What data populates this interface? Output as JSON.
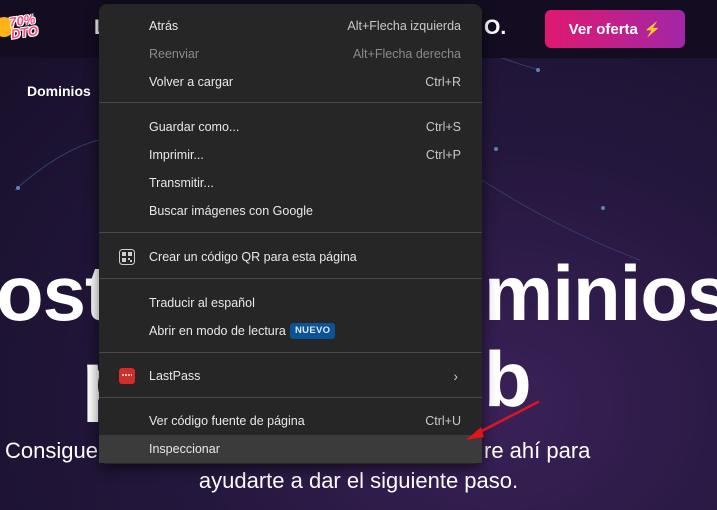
{
  "page": {
    "promo_badge": "70% DTO",
    "promo_left": "L",
    "promo_right": "O.",
    "offer_button": "Ver oferta",
    "offer_icon": "⚡",
    "nav_domains": "Dominios",
    "hero_line1_left": "ost",
    "hero_line1_right": "minios",
    "hero_line2_left": "p",
    "hero_line2_right": "b",
    "subtitle_left": "Consigue",
    "subtitle_right": "re ahí para",
    "subtitle_line2": "ayudarte a dar el siguiente paso.",
    "colors": {
      "offer_gradient_start": "#e0196e",
      "offer_gradient_end": "#a226a8",
      "arrow": "#e0151b"
    }
  },
  "context_menu": {
    "back": {
      "label": "Atrás",
      "shortcut": "Alt+Flecha izquierda"
    },
    "forward": {
      "label": "Reenviar",
      "shortcut": "Alt+Flecha derecha"
    },
    "reload": {
      "label": "Volver a cargar",
      "shortcut": "Ctrl+R"
    },
    "save_as": {
      "label": "Guardar como...",
      "shortcut": "Ctrl+S"
    },
    "print": {
      "label": "Imprimir...",
      "shortcut": "Ctrl+P"
    },
    "cast": {
      "label": "Transmitir..."
    },
    "search_images": {
      "label": "Buscar imágenes con Google"
    },
    "qr_code": {
      "label": "Crear un código QR para esta página",
      "icon": "qr-code-icon"
    },
    "translate": {
      "label": "Traducir al español"
    },
    "reader_mode": {
      "label": "Abrir en modo de lectura",
      "badge": "NUEVO"
    },
    "lastpass": {
      "label": "LastPass",
      "icon": "lastpass-icon"
    },
    "view_source": {
      "label": "Ver código fuente de página",
      "shortcut": "Ctrl+U"
    },
    "inspect": {
      "label": "Inspeccionar"
    }
  }
}
